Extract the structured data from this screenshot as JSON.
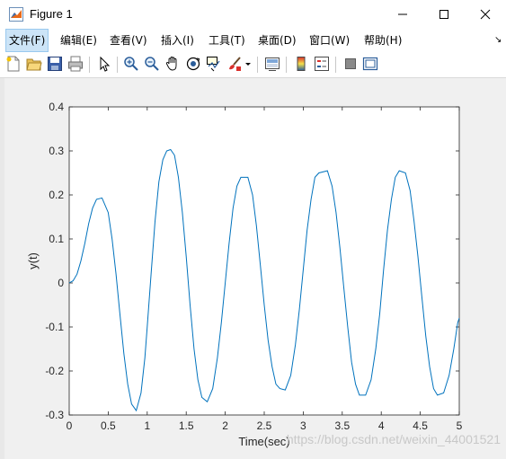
{
  "window": {
    "title": "Figure 1",
    "minimize_icon": "minimize-icon",
    "maximize_icon": "maximize-icon",
    "close_icon": "close-icon"
  },
  "menubar": {
    "items": [
      {
        "label": "文件(F)"
      },
      {
        "label": "编辑(E)"
      },
      {
        "label": "查看(V)"
      },
      {
        "label": "插入(I)"
      },
      {
        "label": "工具(T)"
      },
      {
        "label": "桌面(D)"
      },
      {
        "label": "窗口(W)"
      },
      {
        "label": "帮助(H)"
      }
    ]
  },
  "toolbar": {
    "icons": [
      "new-figure-icon",
      "open-file-icon",
      "save-icon",
      "print-icon",
      "pointer-icon",
      "zoom-in-icon",
      "zoom-out-icon",
      "pan-icon",
      "rotate-3d-icon",
      "data-cursor-icon",
      "brush-icon",
      "brush-dropdown-icon",
      "link-plot-icon",
      "colorbar-icon",
      "legend-icon",
      "hide-plot-tools-icon",
      "show-plot-tools-icon"
    ]
  },
  "watermark": "https://blog.csdn.net/weixin_44001521",
  "chart_data": {
    "type": "line",
    "title": "",
    "xlabel": "Time(sec)",
    "ylabel": "y(t)",
    "xlim": [
      0,
      5
    ],
    "ylim": [
      -0.3,
      0.4
    ],
    "xticks": [
      "0",
      "0.5",
      "1",
      "1.5",
      "2",
      "2.5",
      "3",
      "3.5",
      "4",
      "4.5",
      "5"
    ],
    "yticks": [
      "-0.3",
      "-0.2",
      "-0.1",
      "0",
      "0.1",
      "0.2",
      "0.3",
      "0.4"
    ],
    "line_color": "#0072bd",
    "grid": false,
    "series": [
      {
        "x": [
          0,
          0.05,
          0.1,
          0.15,
          0.2,
          0.25,
          0.3,
          0.35,
          0.42,
          0.5,
          0.55,
          0.6,
          0.65,
          0.7,
          0.75,
          0.8,
          0.86,
          0.92,
          0.97,
          1.0,
          1.05,
          1.1,
          1.15,
          1.2,
          1.25,
          1.3,
          1.35,
          1.4,
          1.45,
          1.5,
          1.55,
          1.6,
          1.65,
          1.7,
          1.77,
          1.84,
          1.9,
          1.95,
          2.0,
          2.05,
          2.1,
          2.15,
          2.2,
          2.29,
          2.35,
          2.4,
          2.45,
          2.5,
          2.55,
          2.6,
          2.65,
          2.7,
          2.77,
          2.84,
          2.9,
          2.95,
          3.0,
          3.05,
          3.1,
          3.15,
          3.2,
          3.31,
          3.37,
          3.42,
          3.47,
          3.52,
          3.57,
          3.62,
          3.67,
          3.72,
          3.8,
          3.87,
          3.93,
          3.98,
          4.03,
          4.08,
          4.13,
          4.18,
          4.23,
          4.31,
          4.37,
          4.42,
          4.47,
          4.52,
          4.57,
          4.62,
          4.67,
          4.72,
          4.8,
          4.87,
          4.93,
          4.98,
          5.0
        ],
        "y": [
          0,
          0.005,
          0.02,
          0.05,
          0.09,
          0.135,
          0.17,
          0.19,
          0.193,
          0.16,
          0.1,
          0.02,
          -0.07,
          -0.16,
          -0.23,
          -0.275,
          -0.29,
          -0.25,
          -0.17,
          -0.1,
          0.02,
          0.14,
          0.23,
          0.28,
          0.3,
          0.303,
          0.29,
          0.24,
          0.16,
          0.06,
          -0.05,
          -0.15,
          -0.22,
          -0.26,
          -0.27,
          -0.24,
          -0.17,
          -0.09,
          0.0,
          0.09,
          0.17,
          0.22,
          0.24,
          0.24,
          0.2,
          0.13,
          0.04,
          -0.05,
          -0.13,
          -0.19,
          -0.23,
          -0.24,
          -0.243,
          -0.21,
          -0.14,
          -0.06,
          0.03,
          0.12,
          0.19,
          0.24,
          0.25,
          0.255,
          0.22,
          0.16,
          0.08,
          -0.01,
          -0.1,
          -0.18,
          -0.23,
          -0.255,
          -0.255,
          -0.22,
          -0.15,
          -0.07,
          0.03,
          0.12,
          0.19,
          0.24,
          0.255,
          0.25,
          0.21,
          0.14,
          0.06,
          -0.03,
          -0.12,
          -0.19,
          -0.24,
          -0.255,
          -0.25,
          -0.21,
          -0.15,
          -0.09,
          -0.08
        ]
      }
    ]
  }
}
